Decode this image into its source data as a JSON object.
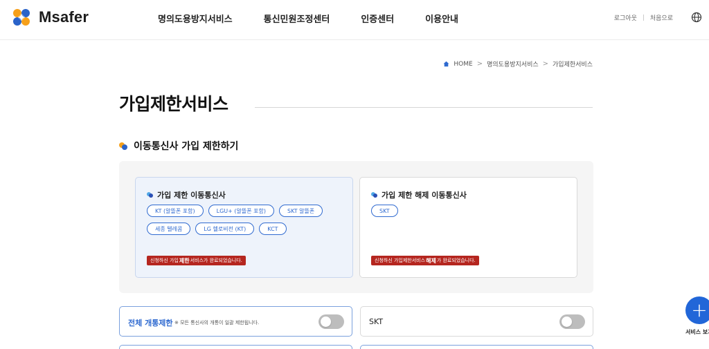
{
  "header": {
    "logo_text": "Msafer",
    "nav": [
      "명의도용방지서비스",
      "통신민원조정센터",
      "인증센터",
      "이용안내"
    ],
    "logout": "로그아웃",
    "home_link": "처음으로",
    "language_icon": "globe-icon"
  },
  "breadcrumb": {
    "home": "HOME",
    "level1": "명의도용방지서비스",
    "level2": "가입제한서비스"
  },
  "page_title": "가입제한서비스",
  "section_title": "이동통신사 가입 제한하기",
  "restricted_card": {
    "title": "가입 제한 이동통신사",
    "carriers": [
      "KT (알뜰폰 포함)",
      "LGU+ (알뜰폰 포함)",
      "SKT 알뜰폰",
      "세종 텔레콤",
      "LG 헬로비전 (KT)",
      "KCT"
    ],
    "notice_pre": "신청하신 가입",
    "notice_bold": "제한",
    "notice_post": "서비스가 완료되었습니다."
  },
  "released_card": {
    "title": "가입 제한 해제 이동통신사",
    "carriers": [
      "SKT"
    ],
    "notice_pre": "신청하신 가입제한서비스",
    "notice_bold": "해제",
    "notice_post": "가 완료되었습니다."
  },
  "toggles": {
    "all_label": "전체 개통제한",
    "all_desc": "※ 모든 통신사의 개통이 일괄 제한됩니다.",
    "all_on": false,
    "skt_label": "SKT",
    "skt_on": false
  },
  "fab": {
    "symbol": "+",
    "label": "서비스 보기"
  },
  "colors": {
    "accent": "#2f6ad0",
    "notice": "#b5261f",
    "logo_orange": "#f6a01a",
    "logo_blue": "#2a63c9"
  }
}
